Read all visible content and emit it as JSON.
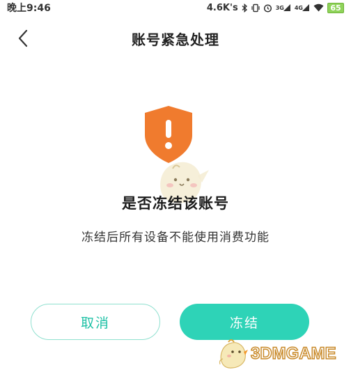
{
  "status_bar": {
    "time": "晚上9:46",
    "network_speed": "4.6K's",
    "signal_3g": "3G",
    "signal_4g": "4G",
    "battery": "65",
    "icons": [
      "bluetooth-icon",
      "vibrate-icon",
      "alarm-icon",
      "signal-icon",
      "signal-icon",
      "wifi-icon",
      "battery-icon"
    ]
  },
  "header": {
    "back_icon": "chevron-left-icon",
    "title": "账号紧急处理"
  },
  "dialog": {
    "icon": "warning-shield-icon",
    "title": "是否冻结该账号",
    "description": "冻结后所有设备不能使用消费功能"
  },
  "actions": {
    "cancel_label": "取消",
    "freeze_label": "冻结"
  },
  "watermark": {
    "text": "3DMGAME"
  },
  "colors": {
    "shield": "#f07b2e",
    "accent": "#2ed3b7",
    "accent_text": "#1fc1a6",
    "accent_border": "#8fe0cf"
  }
}
